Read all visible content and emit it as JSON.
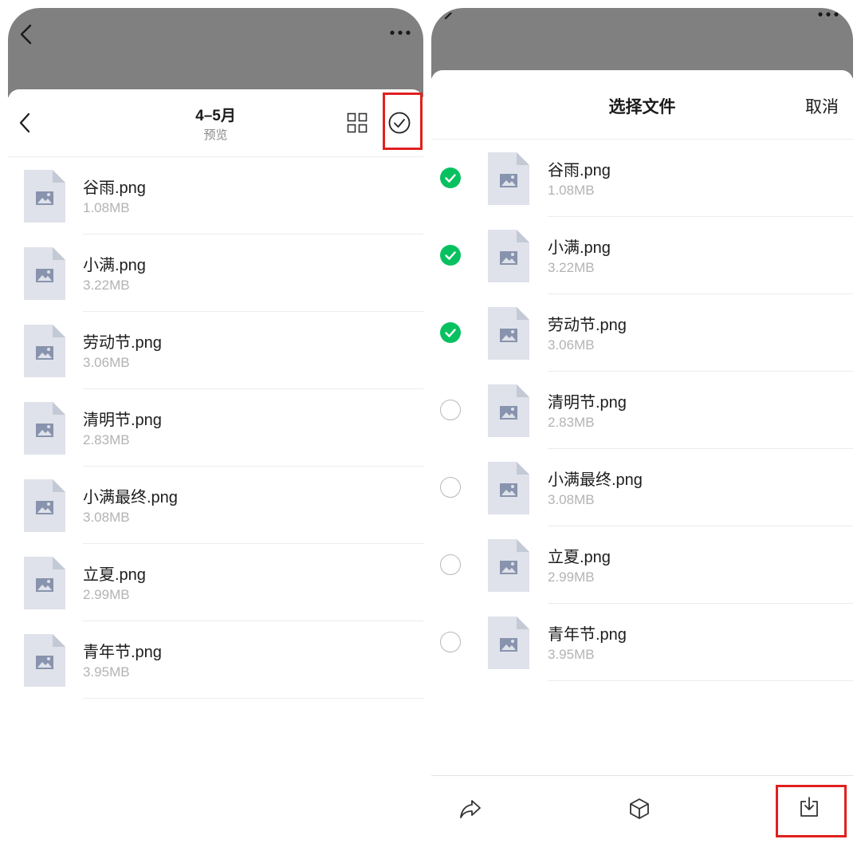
{
  "colors": {
    "accent_green": "#07c160",
    "highlight_red": "#e0201f",
    "gray_overlay": "#808080",
    "file_icon_bg": "#dfe2ea"
  },
  "left": {
    "title": "4–5月",
    "subtitle": "预览",
    "icons": [
      "back-icon",
      "more-icon",
      "grid-view-icon",
      "select-circle-check-icon"
    ],
    "files": [
      {
        "name": "谷雨.png",
        "size": "1.08MB"
      },
      {
        "name": "小满.png",
        "size": "3.22MB"
      },
      {
        "name": "劳动节.png",
        "size": "3.06MB"
      },
      {
        "name": "清明节.png",
        "size": "2.83MB"
      },
      {
        "name": "小满最终.png",
        "size": "3.08MB"
      },
      {
        "name": "立夏.png",
        "size": "2.99MB"
      },
      {
        "name": "青年节.png",
        "size": "3.95MB"
      }
    ]
  },
  "right": {
    "title": "选择文件",
    "cancel": "取消",
    "files": [
      {
        "name": "谷雨.png",
        "size": "1.08MB",
        "selected": true
      },
      {
        "name": "小满.png",
        "size": "3.22MB",
        "selected": true
      },
      {
        "name": "劳动节.png",
        "size": "3.06MB",
        "selected": true
      },
      {
        "name": "清明节.png",
        "size": "2.83MB",
        "selected": false
      },
      {
        "name": "小满最终.png",
        "size": "3.08MB",
        "selected": false
      },
      {
        "name": "立夏.png",
        "size": "2.99MB",
        "selected": false
      },
      {
        "name": "青年节.png",
        "size": "3.95MB",
        "selected": false
      }
    ],
    "toolbar": [
      "share-icon",
      "box-icon",
      "download-icon"
    ]
  }
}
